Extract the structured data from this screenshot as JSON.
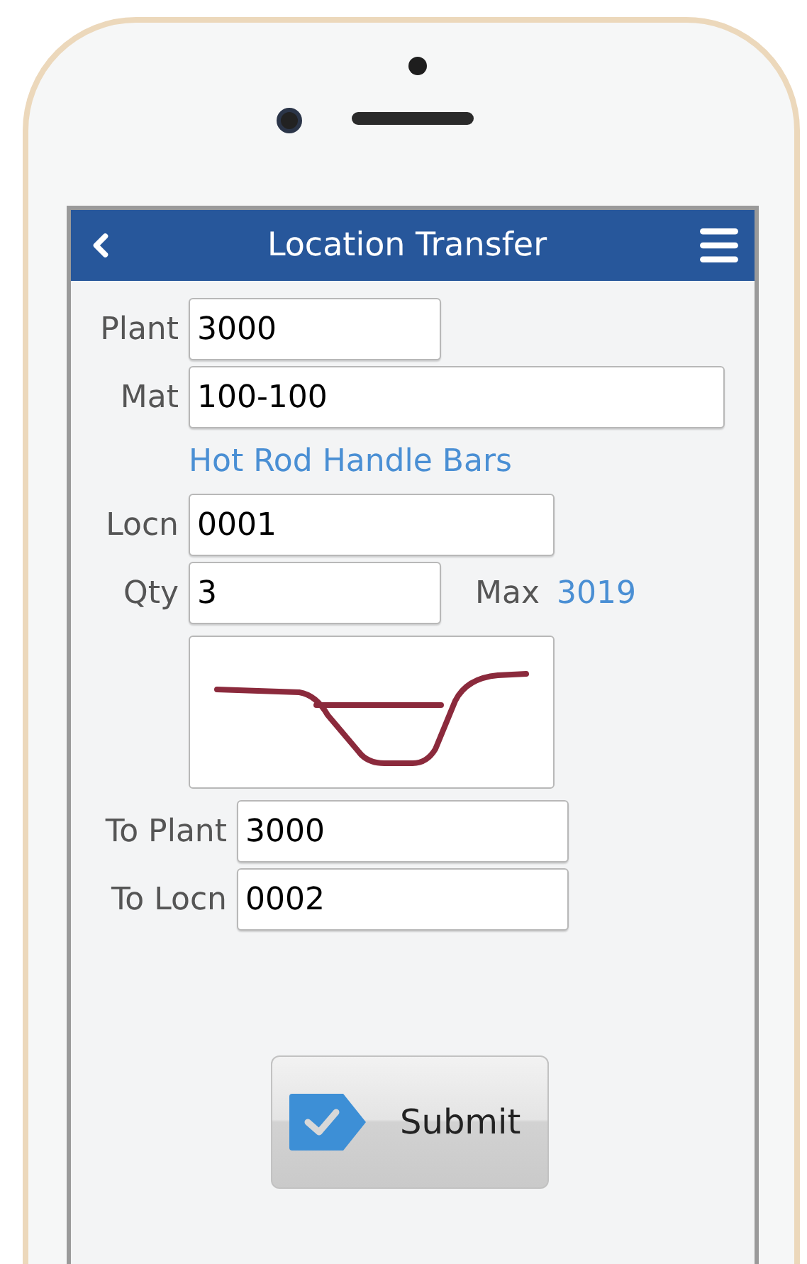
{
  "header": {
    "title": "Location Transfer"
  },
  "plant": {
    "label": "Plant",
    "value": "3000"
  },
  "material": {
    "label": "Mat",
    "value": "100-100",
    "description": "Hot Rod Handle Bars"
  },
  "location": {
    "label": "Locn",
    "value": "0001"
  },
  "quantity": {
    "label": "Qty",
    "value": "3",
    "max_label": "Max",
    "max_value": "3019"
  },
  "to_plant": {
    "label": "To Plant",
    "value": "3000"
  },
  "to_location": {
    "label": "To Locn",
    "value": "0002"
  },
  "submit_button": {
    "label": "Submit"
  }
}
